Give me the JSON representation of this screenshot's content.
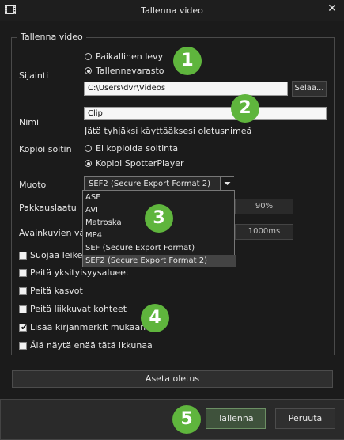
{
  "window": {
    "title": "Tallenna video"
  },
  "group": {
    "title": "Tallenna video"
  },
  "location": {
    "label": "Sijainti",
    "option_local": "Paikallinen levy",
    "option_storage": "Tallennevarasto",
    "path": "C:\\Users\\dvr\\Videos",
    "browse_label": "Selaa..."
  },
  "name": {
    "label": "Nimi",
    "value": "Clip",
    "hint": "Jätä tyhjäksi käyttääksesi oletusnimeä"
  },
  "copy_player": {
    "label": "Kopioi soitin",
    "option_no": "Ei kopioida soitinta",
    "option_yes": "Kopioi SpotterPlayer"
  },
  "format": {
    "label": "Muoto",
    "selected": "SEF2 (Secure Export Format 2)",
    "options": [
      "ASF",
      "AVI",
      "Matroska",
      "MP4",
      "SEF (Secure Export Format)",
      "SEF2 (Secure Export Format 2)"
    ]
  },
  "compression": {
    "label": "Pakkauslaatu",
    "value": "90%"
  },
  "keyframe": {
    "label": "Avainkuvien väli",
    "value": "1000ms"
  },
  "checkboxes": [
    {
      "label": "Suojaa leike sa",
      "checked": false
    },
    {
      "label": "Peitä yksityisyysalueet",
      "checked": false
    },
    {
      "label": "Peitä kasvot",
      "checked": false
    },
    {
      "label": "Peitä liikkuvat kohteet",
      "checked": false
    },
    {
      "label": "Lisää kirjanmerkit mukaan",
      "checked": true
    },
    {
      "label": "Älä näytä enää tätä ikkunaa",
      "checked": false
    }
  ],
  "buttons": {
    "set_default": "Aseta oletus",
    "save": "Tallenna",
    "cancel": "Peruuta"
  },
  "badges": [
    "1",
    "2",
    "3",
    "4",
    "5"
  ],
  "colors": {
    "badge": "#5fb53d",
    "dark_bg": "#1b1b1b"
  }
}
